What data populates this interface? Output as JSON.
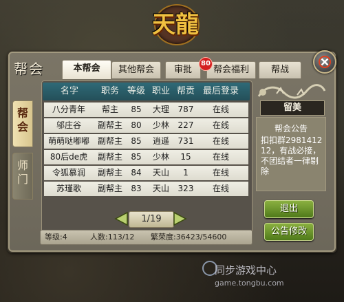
{
  "logo": {
    "text": "天龍"
  },
  "panel": {
    "title": "帮会"
  },
  "tabs": [
    {
      "label": "本帮会",
      "active": true
    },
    {
      "label": "其他帮会",
      "active": false
    },
    {
      "label": "审批",
      "active": false
    },
    {
      "label": "帮会福利",
      "active": false
    },
    {
      "label": "帮战",
      "active": false
    }
  ],
  "badge": {
    "count": "80"
  },
  "side_tabs": [
    {
      "label": "帮会",
      "active": true
    },
    {
      "label": "师门",
      "active": false
    }
  ],
  "table": {
    "headers": [
      "名字",
      "职务",
      "等级",
      "职业",
      "帮贡",
      "最后登录"
    ],
    "rows": [
      [
        "八分青年",
        "帮主",
        "85",
        "大理",
        "787",
        "在线"
      ],
      [
        "邬庄谷",
        "副帮主",
        "80",
        "少林",
        "227",
        "在线"
      ],
      [
        "萌萌哒嘟嘟",
        "副帮主",
        "85",
        "逍遥",
        "731",
        "在线"
      ],
      [
        "80后de虎",
        "副帮主",
        "85",
        "少林",
        "15",
        "在线"
      ],
      [
        "令狐慕润",
        "副帮主",
        "84",
        "天山",
        "1",
        "在线"
      ],
      [
        "苏瑾歌",
        "副帮主",
        "83",
        "天山",
        "323",
        "在线"
      ]
    ]
  },
  "pager": {
    "label": "1/19"
  },
  "footer": {
    "level": "等级:4",
    "members": "人数:113/12",
    "prosperity": "繁荣度:36423/54600"
  },
  "right": {
    "member_name": "留美",
    "notice_title": "帮会公告",
    "notice_body": "扣扣群298141212，有战必接，不团结者一律剔除",
    "quit_label": "退出",
    "edit_label": "公告修改"
  },
  "watermark": {
    "text": "同步游戏中心",
    "url": "game.tongbu.com"
  },
  "colors": {
    "accent": "#2f6a77",
    "button": "#6a9a2a",
    "badge": "#d42020"
  }
}
